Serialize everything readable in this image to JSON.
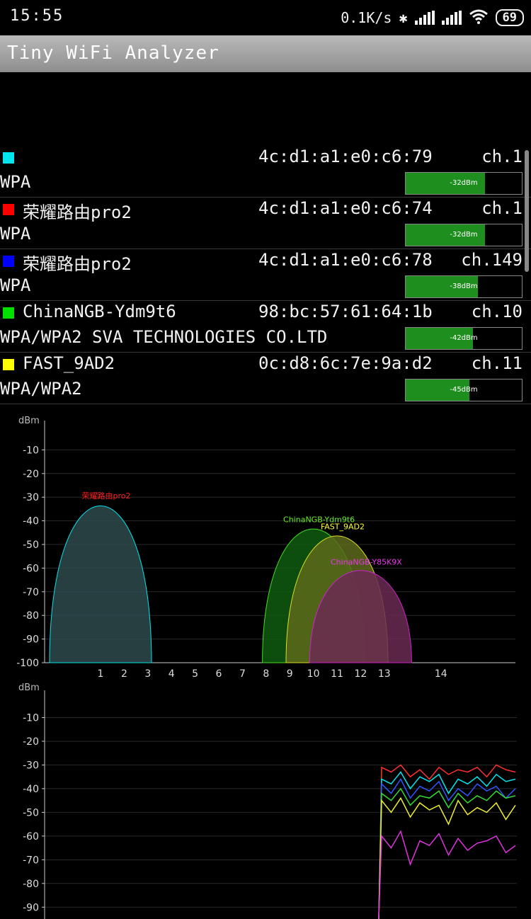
{
  "status": {
    "time": "15:55",
    "speed": "0.1K/s",
    "battery": "69"
  },
  "app": {
    "title": "Tiny WiFi Analyzer"
  },
  "networks": [
    {
      "ssid": "",
      "mac": "4c:d1:a1:e0:c6:79",
      "channel": "ch.1",
      "security": "WPA",
      "level": "-32dBm",
      "fill": 0.68,
      "color": "#00e5ee"
    },
    {
      "ssid": "荣耀路由pro2",
      "mac": "4c:d1:a1:e0:c6:74",
      "channel": "ch.1",
      "security": "WPA",
      "level": "-32dBm",
      "fill": 0.68,
      "color": "#ff0000"
    },
    {
      "ssid": "荣耀路由pro2",
      "mac": "4c:d1:a1:e0:c6:78",
      "channel": "ch.149",
      "security": "WPA",
      "level": "-38dBm",
      "fill": 0.62,
      "color": "#0000ff"
    },
    {
      "ssid": "ChinaNGB-Ydm9t6",
      "mac": "98:bc:57:61:64:1b",
      "channel": "ch.10",
      "security": "WPA/WPA2 SVA TECHNOLOGIES CO.LTD",
      "level": "-42dBm",
      "fill": 0.58,
      "color": "#00e000"
    },
    {
      "ssid": "FAST_9AD2",
      "mac": "0c:d8:6c:7e:9a:d2",
      "channel": "ch.11",
      "security": "WPA/WPA2",
      "level": "-45dBm",
      "fill": 0.55,
      "color": "#ffff00"
    }
  ],
  "chart_data": [
    {
      "type": "area",
      "ylabel": "dBm",
      "yticks": [
        "-10",
        "-20",
        "-30",
        "-40",
        "-50",
        "-60",
        "-70",
        "-80",
        "-90",
        "-100"
      ],
      "ylim": [
        -100,
        0
      ],
      "xticks": [
        "1",
        "2",
        "3",
        "4",
        "5",
        "6",
        "7",
        "8",
        "9",
        "10",
        "11",
        "12",
        "13",
        "14"
      ],
      "grid": true,
      "series": [
        {
          "name": "荣耀路由pro2",
          "channel": 1,
          "dbm": -32,
          "stroke": "#00e5ee",
          "fill": "#2f4a4e",
          "label_color": "#ff2020"
        },
        {
          "name": "ChinaNGB-Ydm9t6",
          "channel": 10,
          "dbm": -42,
          "stroke": "#44dd22",
          "fill": "#0f5a0f",
          "label_color": "#66ee22"
        },
        {
          "name": "FAST_9AD2",
          "channel": 11,
          "dbm": -45,
          "stroke": "#dddd22",
          "fill": "#5e6a1c",
          "label_color": "#ffff33"
        },
        {
          "name": "ChinaNGB-Y85K9X",
          "channel": 12,
          "dbm": -60,
          "stroke": "#cc22cc",
          "fill": "#6a2a52",
          "label_color": "#ee33ee"
        }
      ]
    },
    {
      "type": "line",
      "ylabel": "dBm",
      "yticks": [
        "-10",
        "-20",
        "-30",
        "-40",
        "-50",
        "-60",
        "-70",
        "-80",
        "-90"
      ],
      "ylim": [
        -95,
        0
      ],
      "grid": true,
      "series": [
        {
          "color": "#ff3030",
          "values": [
            -31,
            -33,
            -30,
            -35,
            -32,
            -36,
            -31,
            -34,
            -32,
            -33,
            -31,
            -35,
            -30,
            -32,
            -33
          ]
        },
        {
          "color": "#00e5ee",
          "values": [
            -36,
            -38,
            -33,
            -40,
            -35,
            -37,
            -34,
            -42,
            -36,
            -38,
            -35,
            -39,
            -34,
            -37,
            -36
          ]
        },
        {
          "color": "#3355ff",
          "values": [
            -38,
            -42,
            -36,
            -44,
            -39,
            -41,
            -37,
            -45,
            -40,
            -43,
            -38,
            -41,
            -39,
            -44,
            -40
          ]
        },
        {
          "color": "#33dd33",
          "values": [
            -42,
            -45,
            -40,
            -47,
            -43,
            -44,
            -41,
            -48,
            -42,
            -46,
            -43,
            -45,
            -41,
            -44,
            -43
          ]
        },
        {
          "color": "#eeee33",
          "values": [
            -45,
            -50,
            -44,
            -52,
            -46,
            -49,
            -47,
            -55,
            -45,
            -51,
            -48,
            -50,
            -46,
            -53,
            -47
          ]
        },
        {
          "color": "#dd33dd",
          "values": [
            -60,
            -65,
            -58,
            -72,
            -62,
            -64,
            -59,
            -68,
            -61,
            -66,
            -63,
            -62,
            -60,
            -67,
            -64
          ]
        }
      ]
    }
  ]
}
